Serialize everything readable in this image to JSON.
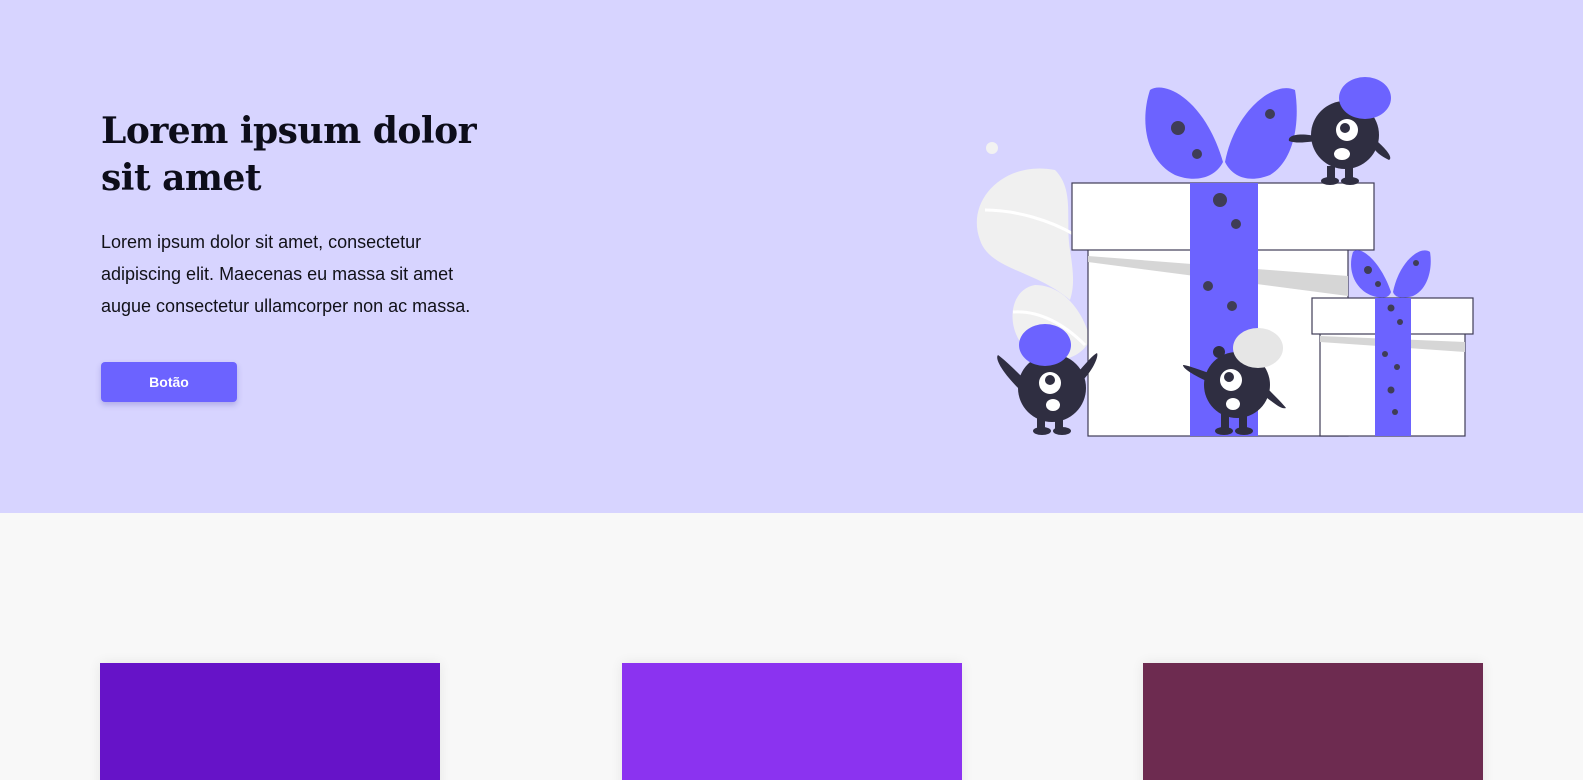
{
  "hero": {
    "title_line1": "Lorem ipsum dolor",
    "title_line2": "sit amet",
    "description": "Lorem ipsum dolor sit amet, consectetur adipiscing elit. Maecenas eu massa sit amet augue consectetur ullamcorper non ac massa.",
    "button_label": "Botão"
  },
  "colors": {
    "hero_background": "#d7d4ff",
    "accent": "#6c63ff",
    "section_background": "#f8f8f8",
    "card_1": "#6613c8",
    "card_2": "#8b33f0",
    "card_3": "#6d2b50"
  },
  "illustration": {
    "icon": "gift-boxes-monsters-illustration"
  },
  "cards": [
    {
      "name": "card-1",
      "color": "#6613c8"
    },
    {
      "name": "card-2",
      "color": "#8b33f0"
    },
    {
      "name": "card-3",
      "color": "#6d2b50"
    }
  ]
}
